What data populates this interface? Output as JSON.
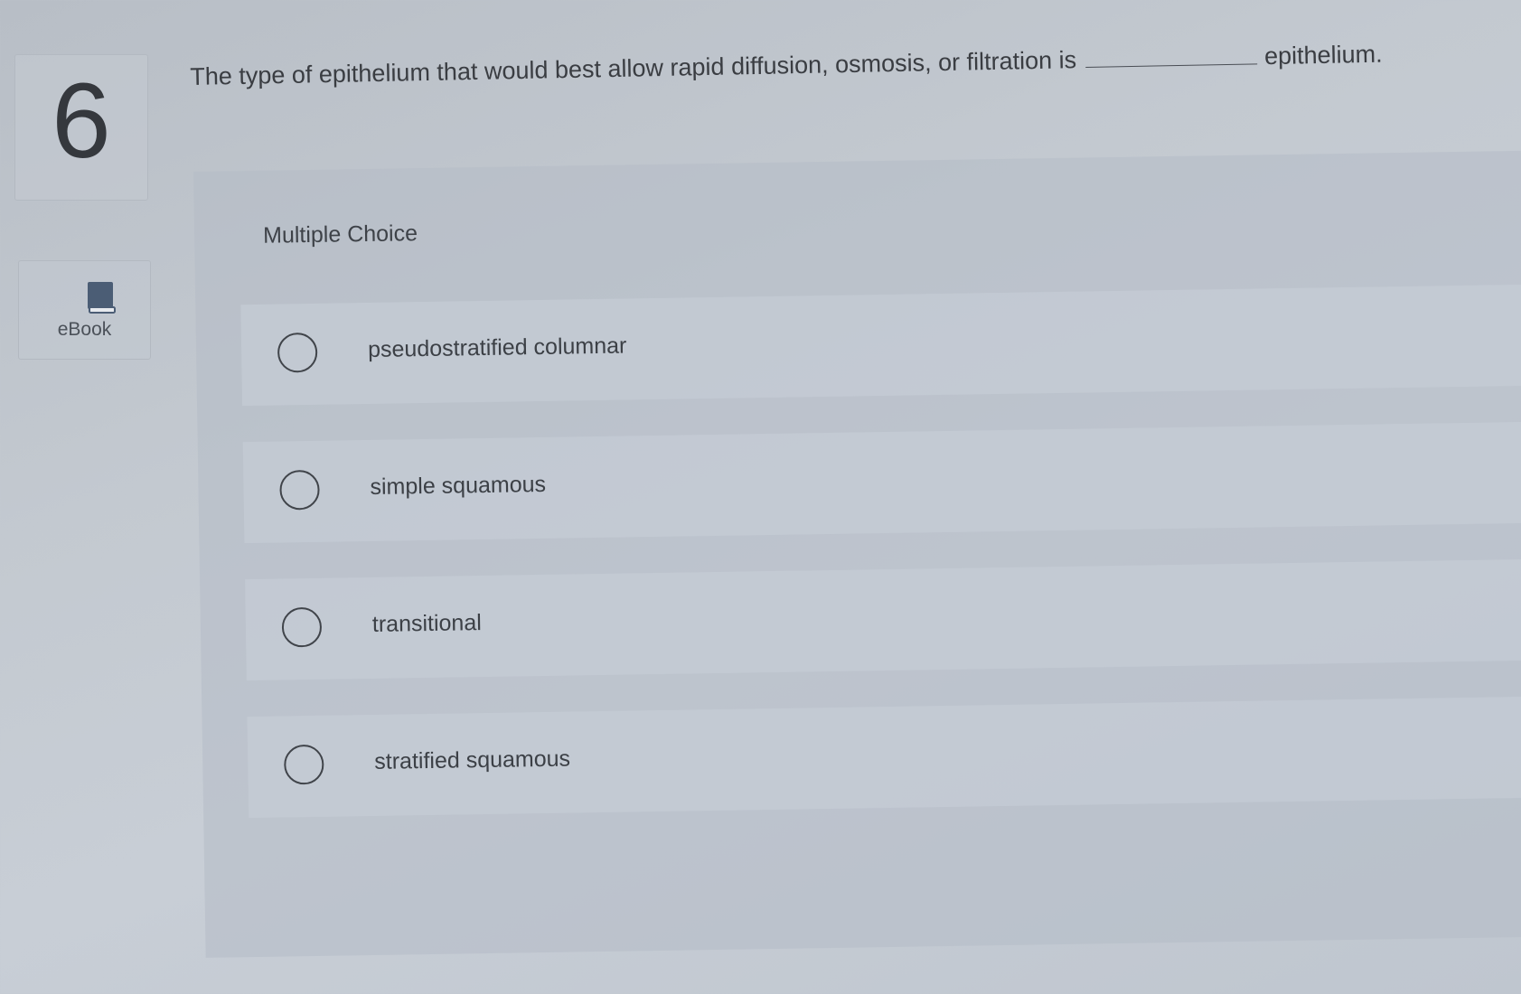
{
  "question": {
    "number": "6",
    "text_before_blank": "The type of epithelium that would best allow rapid diffusion, osmosis, or filtration is",
    "text_after_blank": "epithelium."
  },
  "sidebar": {
    "ebook_label": "eBook",
    "ebook_icon": "book-icon"
  },
  "answer_panel": {
    "type_label": "Multiple Choice",
    "choices": [
      {
        "label": "pseudostratified columnar",
        "selected": false
      },
      {
        "label": "simple squamous",
        "selected": false
      },
      {
        "label": "transitional",
        "selected": false
      },
      {
        "label": "stratified squamous",
        "selected": false
      }
    ]
  },
  "colors": {
    "background": "#c3c9d0",
    "text": "#3a3d42",
    "ebook_icon": "#4b5d75"
  }
}
